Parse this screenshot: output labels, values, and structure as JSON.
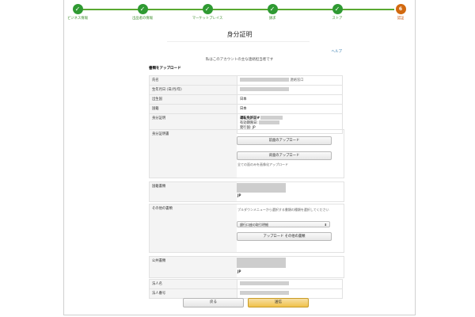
{
  "steps": [
    {
      "label": "ビジネス情報",
      "icon": "checkmark-icon",
      "state": "done"
    },
    {
      "label": "出品者の情報",
      "icon": "checkmark-icon",
      "state": "done"
    },
    {
      "label": "マーケットプレイス",
      "icon": "checkmark-icon",
      "state": "done"
    },
    {
      "label": "請求",
      "icon": "checkmark-icon",
      "state": "done"
    },
    {
      "label": "ストア",
      "icon": "checkmark-icon",
      "state": "done"
    },
    {
      "label": "認証",
      "number": "6",
      "state": "current"
    }
  ],
  "page": {
    "title": "身分証明",
    "help": "ヘルプ",
    "subtitle": "私はこのアカウントの主な連絡担当者です",
    "section_heading": "書類をアップロード"
  },
  "info_rows": [
    {
      "label": "氏名",
      "suffix": "連絡窓口"
    },
    {
      "label": "生年月日 (日/月/年)"
    },
    {
      "label": "出生国",
      "value": "日本"
    },
    {
      "label": "国籍",
      "value": "日本"
    },
    {
      "label": "身分証明",
      "doc_type": "運転免許証#",
      "expiry": "有効期限日:",
      "country": "発行国: JP"
    }
  ],
  "id_doc": {
    "label": "身分証明書",
    "front_button": "前面のアップロード",
    "back_button": "背面のアップロード",
    "note": "全ての面のみを画像化アップロード"
  },
  "country_of_issue": {
    "label": "国籍書類",
    "code": "JP"
  },
  "other_docs": {
    "label": "その他の書類",
    "note": "プルダウンメニューから選択する書類の種類を選択してください",
    "select_value": "銀行口座の取引明細",
    "upload_button": "アップロード その他の書類"
  },
  "address_doc": {
    "label": "公共書類",
    "code": "JP"
  },
  "extra_rows": [
    {
      "label": "法人名"
    },
    {
      "label": "法人番号"
    }
  ],
  "footer": {
    "back_button": "戻る",
    "submit_button": "送信"
  },
  "colors": {
    "done": "#2f9a32",
    "current": "#d2690f",
    "link": "#3a7fb0",
    "primary": "#f0c14b"
  }
}
